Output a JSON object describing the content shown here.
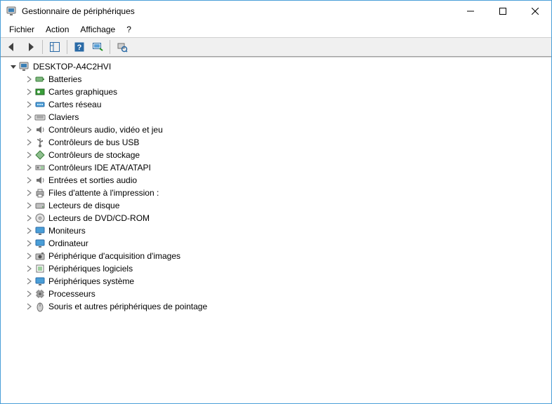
{
  "window": {
    "title": "Gestionnaire de périphériques"
  },
  "menu": {
    "file": "Fichier",
    "action": "Action",
    "view": "Affichage",
    "help": "?"
  },
  "tree": {
    "root": {
      "label": "DESKTOP-A4C2HVI",
      "expanded": true
    },
    "items": [
      {
        "icon": "battery-icon",
        "label": "Batteries"
      },
      {
        "icon": "gpu-icon",
        "label": "Cartes graphiques"
      },
      {
        "icon": "network-icon",
        "label": "Cartes réseau"
      },
      {
        "icon": "keyboard-icon",
        "label": "Claviers"
      },
      {
        "icon": "audio-icon",
        "label": "Contrôleurs audio, vidéo et jeu"
      },
      {
        "icon": "usb-icon",
        "label": "Contrôleurs de bus USB"
      },
      {
        "icon": "storage-icon",
        "label": "Contrôleurs de stockage"
      },
      {
        "icon": "ide-icon",
        "label": "Contrôleurs IDE ATA/ATAPI"
      },
      {
        "icon": "audio-io-icon",
        "label": "Entrées et sorties audio"
      },
      {
        "icon": "printer-icon",
        "label": "Files d'attente à l'impression :"
      },
      {
        "icon": "disk-icon",
        "label": "Lecteurs de disque"
      },
      {
        "icon": "dvd-icon",
        "label": "Lecteurs de DVD/CD-ROM"
      },
      {
        "icon": "monitor-icon",
        "label": "Moniteurs"
      },
      {
        "icon": "computer-icon",
        "label": "Ordinateur"
      },
      {
        "icon": "camera-icon",
        "label": "Périphérique d'acquisition d'images"
      },
      {
        "icon": "software-icon",
        "label": "Périphériques logiciels"
      },
      {
        "icon": "system-icon",
        "label": "Périphériques système"
      },
      {
        "icon": "cpu-icon",
        "label": "Processeurs"
      },
      {
        "icon": "mouse-icon",
        "label": "Souris et autres périphériques de pointage"
      }
    ]
  }
}
